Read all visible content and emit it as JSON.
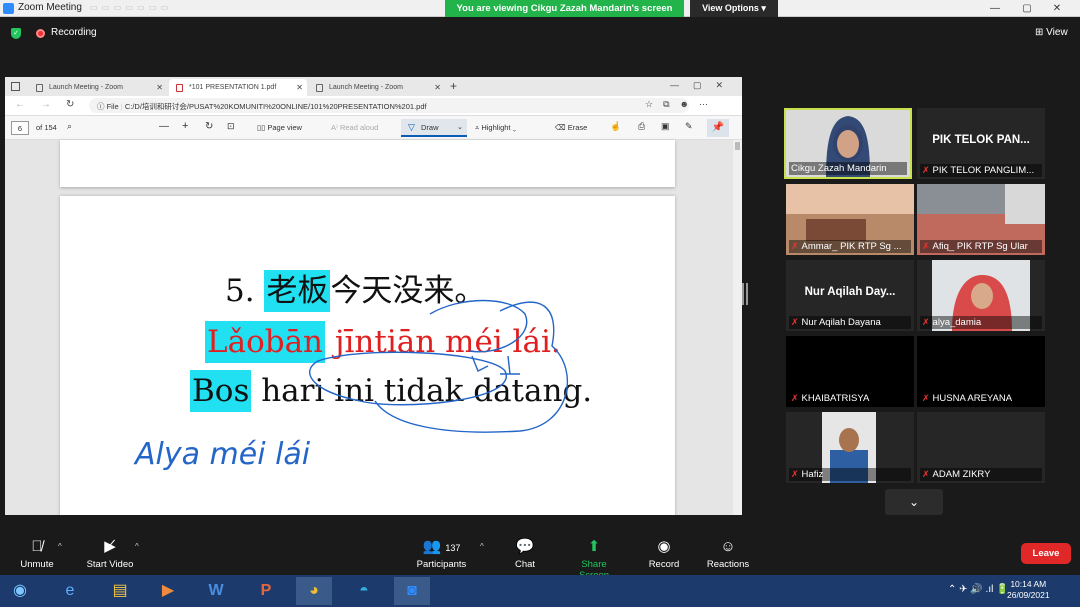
{
  "window": {
    "title": "Zoom Meeting",
    "banner": "You are viewing Cikgu Zazah Mandarin's screen",
    "view_options": "View Options"
  },
  "meeting": {
    "recording": "Recording",
    "view": "View"
  },
  "browser": {
    "tabs": [
      {
        "label": "Launch Meeting - Zoom"
      },
      {
        "label": "*101 PRESENTATION 1.pdf"
      },
      {
        "label": "Launch Meeting - Zoom"
      }
    ],
    "address_prefix": "File",
    "url": "C:/D/培训和研讨会/PUSAT%20KOMUNITI%20ONLINE/101%20PRESENTATION%201.pdf",
    "pdf_toolbar": {
      "page": "6",
      "of_pages": "of 154",
      "page_view": "Page view",
      "read_aloud": "Read aloud",
      "draw": "Draw",
      "highlight": "Highlight",
      "erase": "Erase"
    }
  },
  "slide": {
    "number": "5.",
    "boss_cn": "老板",
    "rest_cn": "今天没来。",
    "boss_pinyin": "Lǎobān",
    "rest_pinyin": " jīntiān méi lái.",
    "boss_malay": "Bos",
    "rest_malay": " hari ini tidak datang.",
    "handwriting": "Alya méi lái"
  },
  "gallery": [
    {
      "name": "Cikgu Zazah Mandarin",
      "video": true
    },
    {
      "name": "PIK TELOK PANGLIM...",
      "center": "PIK TELOK PAN..."
    },
    {
      "name": "Ammar_ PIK RTP Sg ...",
      "video": true
    },
    {
      "name": "Afiq_ PIK RTP Sg Ular",
      "video": true
    },
    {
      "name": "Nur Aqilah Dayana",
      "center": "Nur Aqilah Day..."
    },
    {
      "name": "alya_damia",
      "video": true
    },
    {
      "name": "KHAIBATRISYA"
    },
    {
      "name": "HUSNA AREYANA"
    },
    {
      "name": "Hafiz",
      "video": true
    },
    {
      "name": "ADAM ZIKRY"
    }
  ],
  "controls": {
    "unmute": "Unmute",
    "start_video": "Start Video",
    "participants": "Participants",
    "participants_count": "137",
    "chat": "Chat",
    "share_screen": "Share Screen",
    "record": "Record",
    "reactions": "Reactions",
    "leave": "Leave"
  },
  "taskbar": {
    "time": "10:14 AM",
    "date": "26/09/2021"
  }
}
